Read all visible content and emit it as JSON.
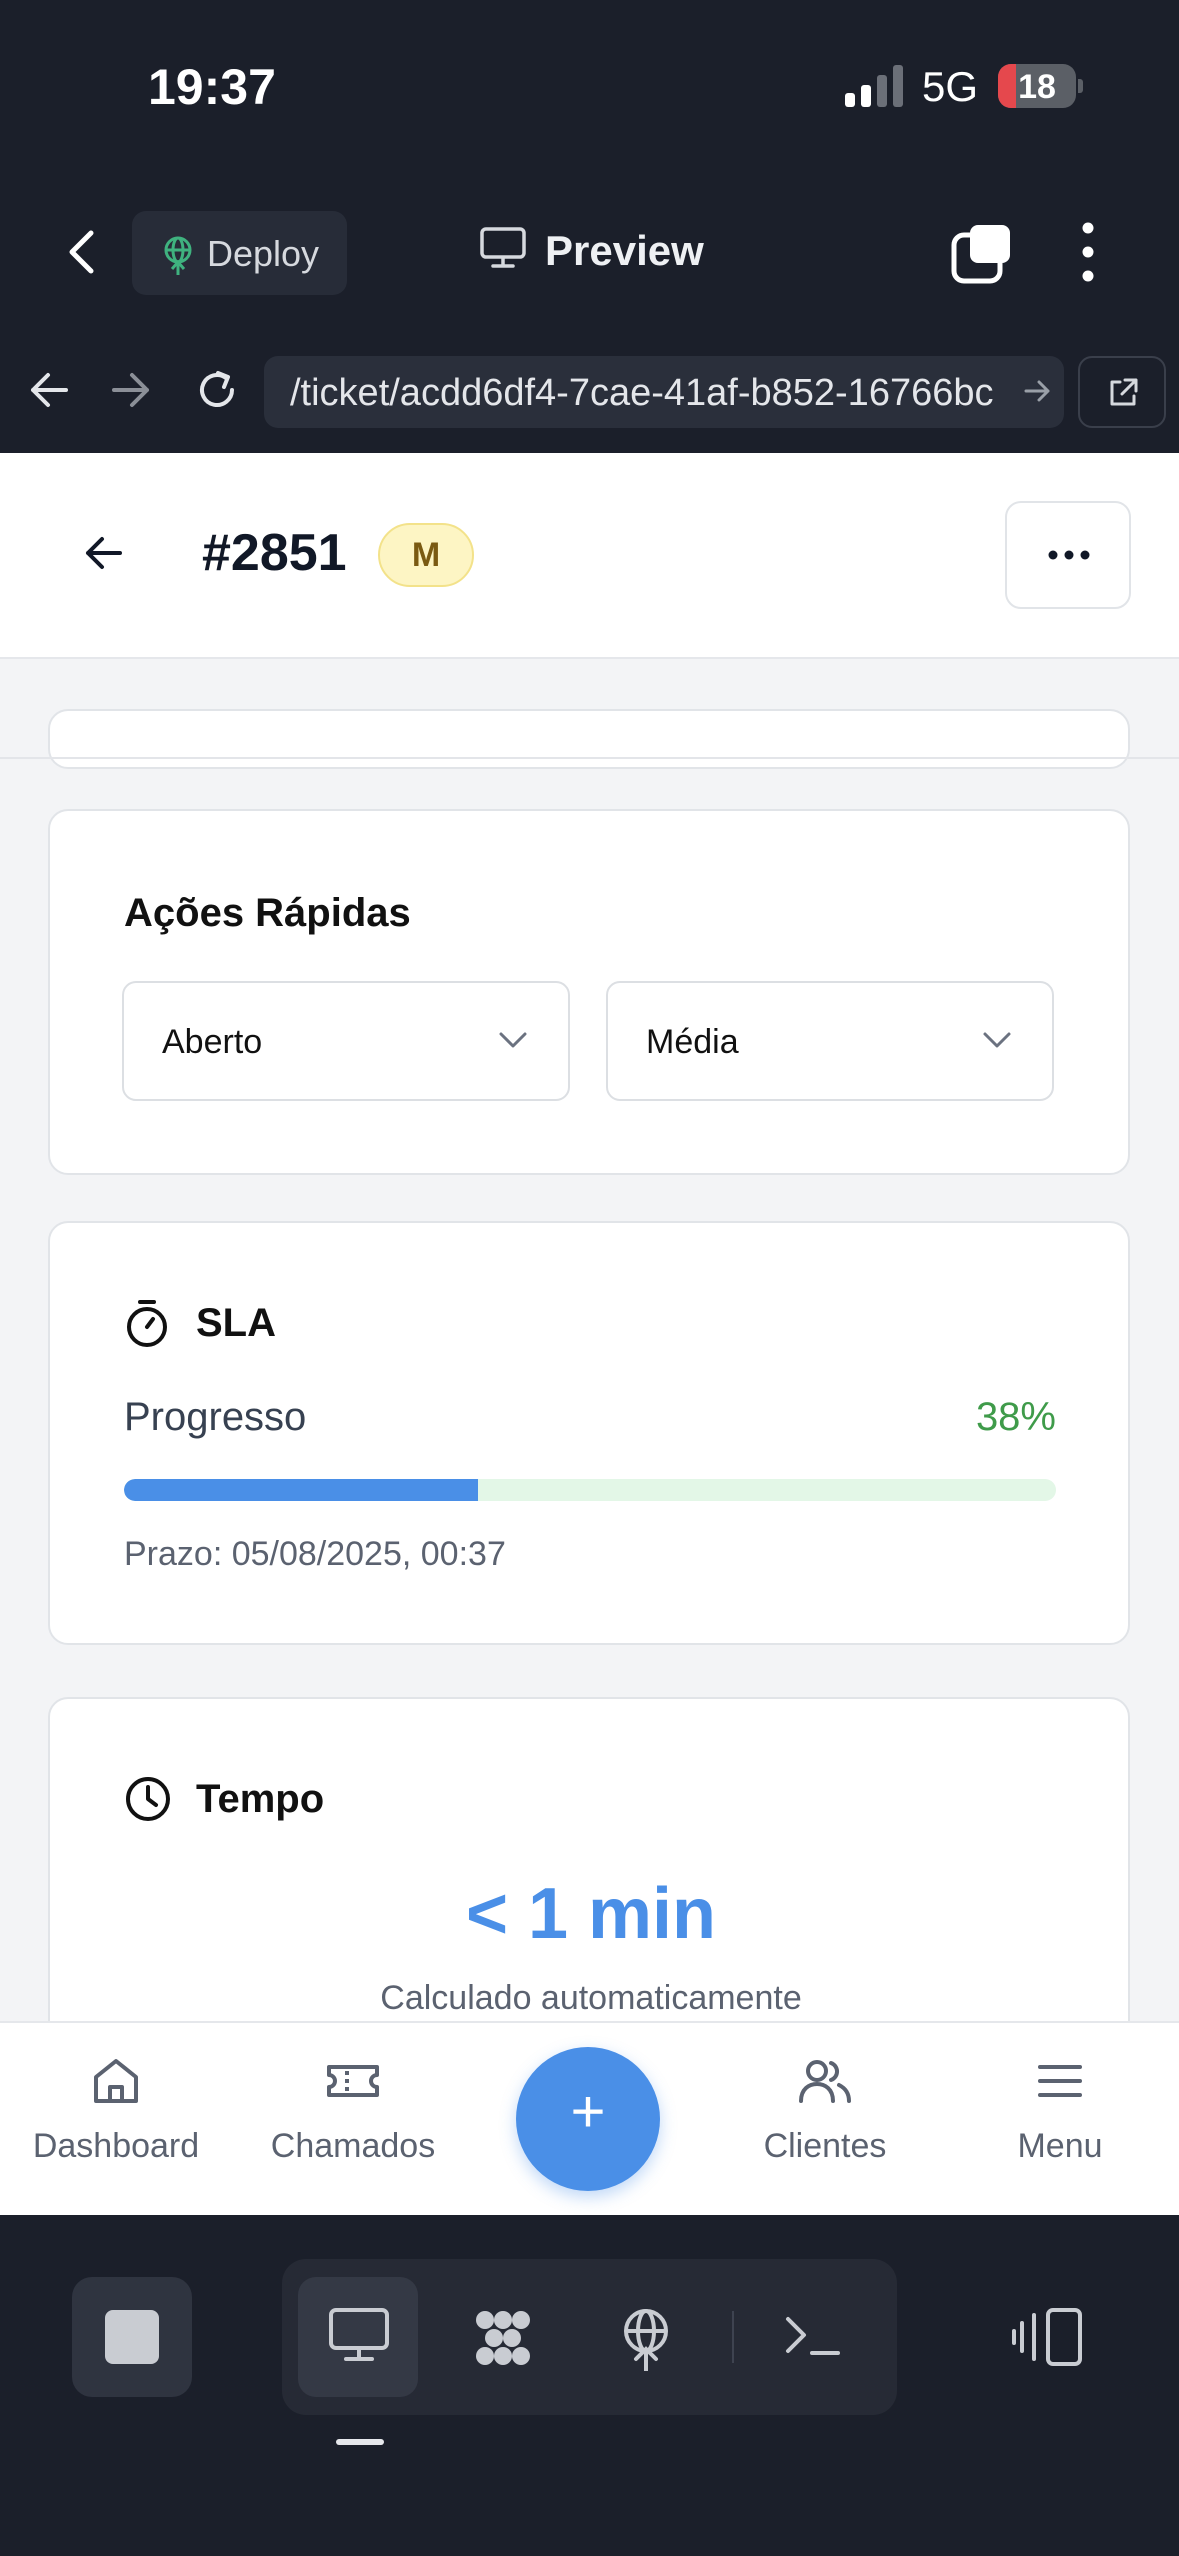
{
  "status_bar": {
    "time": "19:37",
    "network": "5G",
    "battery": "18"
  },
  "app_header": {
    "deploy_label": "Deploy",
    "preview_label": "Preview"
  },
  "browser": {
    "url": "/ticket/acdd6df4-7cae-41af-b852-16766bc"
  },
  "ticket": {
    "number": "#2851",
    "priority_badge": "M"
  },
  "quick_actions": {
    "title": "Ações Rápidas",
    "status_value": "Aberto",
    "priority_value": "Média"
  },
  "sla": {
    "title": "SLA",
    "progress_label": "Progresso",
    "progress_percent": 38,
    "progress_text": "38%",
    "deadline": "Prazo: 05/08/2025, 00:37"
  },
  "time_card": {
    "title": "Tempo",
    "value": "< 1 min",
    "note": "Calculado automaticamente"
  },
  "bottom_nav": {
    "dashboard": "Dashboard",
    "tickets": "Chamados",
    "add": "+",
    "clients": "Clientes",
    "menu": "Menu"
  },
  "colors": {
    "accent": "#4a8fe7",
    "success": "#3f9b4a",
    "badge_bg": "#fdf5c4",
    "track_bg": "#e3f7e7"
  }
}
